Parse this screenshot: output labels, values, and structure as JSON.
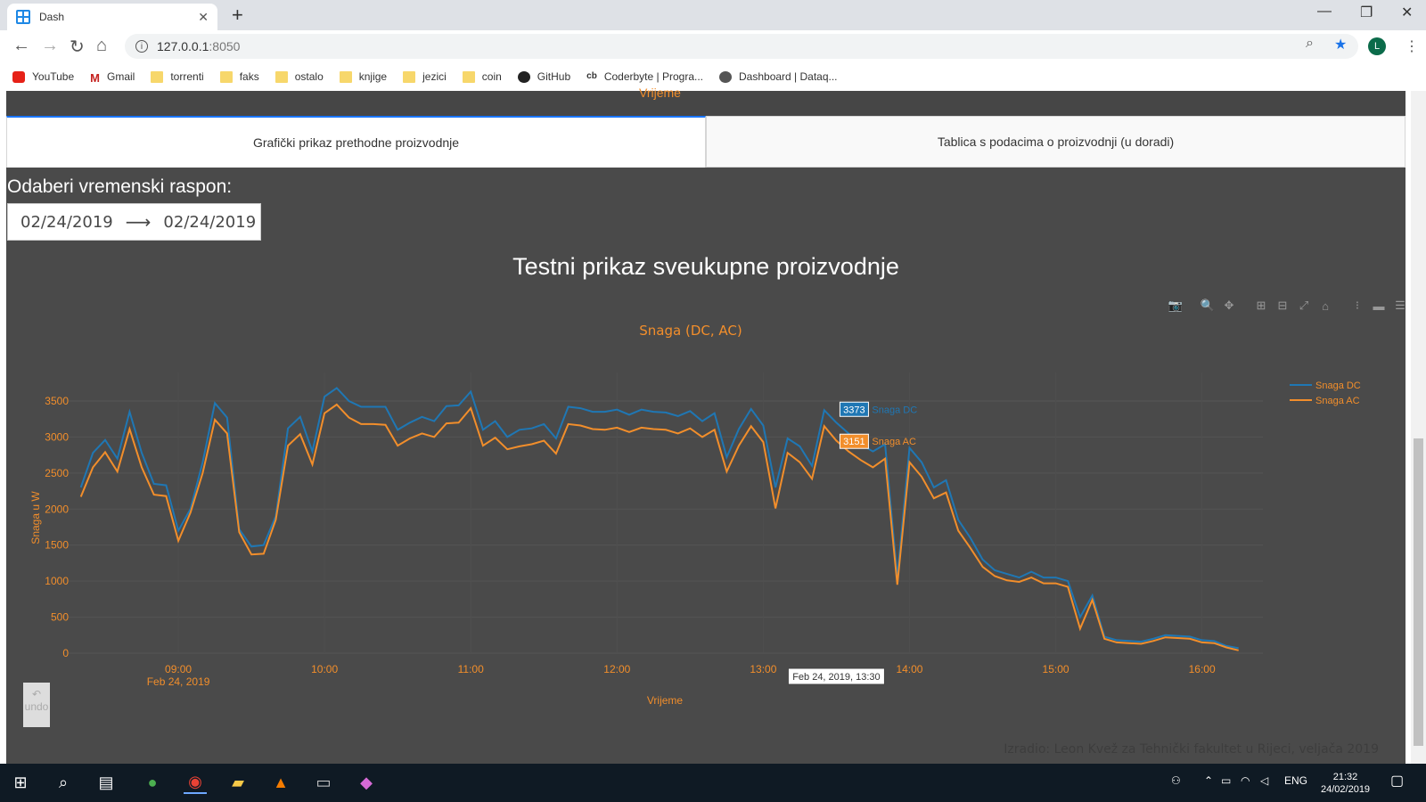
{
  "browser": {
    "tab_title": "Dash",
    "new_tab": "+",
    "url_host": "127.0.0.1",
    "url_port": ":8050",
    "avatar_letter": "L",
    "bookmarks": [
      {
        "label": "YouTube",
        "icon": "youtube-icon"
      },
      {
        "label": "Gmail",
        "icon": "gmail-icon"
      },
      {
        "label": "torrenti",
        "icon": "folder-icon"
      },
      {
        "label": "faks",
        "icon": "folder-icon"
      },
      {
        "label": "ostalo",
        "icon": "folder-icon"
      },
      {
        "label": "knjige",
        "icon": "folder-icon"
      },
      {
        "label": "jezici",
        "icon": "folder-icon"
      },
      {
        "label": "coin",
        "icon": "folder-icon"
      },
      {
        "label": "GitHub",
        "icon": "github-icon"
      },
      {
        "label": "Coderbyte | Progra...",
        "icon": "coderbyte-icon"
      },
      {
        "label": "Dashboard | Dataq...",
        "icon": "dataquest-icon"
      }
    ]
  },
  "page": {
    "strip_label": "Vrijeme",
    "tabs": [
      {
        "label": "Grafički prikaz prethodne proizvodnje",
        "active": true
      },
      {
        "label": "Tablica s podacima o proizvodnji (u doradi)",
        "active": false
      }
    ],
    "range_label": "Odaberi vremenski raspon:",
    "date_start": "02/24/2019",
    "date_end": "02/24/2019",
    "main_title": "Testni prikaz sveukupne proizvodnje",
    "undo_label": "undo",
    "footer": "Izradio: Leon Kvež za Tehnički fakultet u Rijeci, veljača 2019"
  },
  "colors": {
    "dc": "#1f77b4",
    "ac": "#f28e2b",
    "bg": "#4a4a4a",
    "accent_tab": "#1975fa"
  },
  "chart_data": {
    "type": "line",
    "title": "Snaga (DC, AC)",
    "xlabel": "Vrijeme",
    "ylabel": "Snaga u W",
    "ylim": [
      0,
      3700
    ],
    "yticks": [
      0,
      500,
      1000,
      1500,
      2000,
      2500,
      3000,
      3500
    ],
    "xtick_labels": [
      "09:00",
      "10:00",
      "11:00",
      "12:00",
      "13:00",
      "14:00",
      "15:00",
      "16:00"
    ],
    "xtick_date": "Feb 24, 2019",
    "x_start": "08:20",
    "x_step_minutes": 5,
    "legend_position": "top-right",
    "hover": {
      "time": "Feb 24, 2019, 13:30",
      "dc": 3373,
      "ac": 3151
    },
    "series": [
      {
        "name": "Snaga DC",
        "values": [
          2300,
          2780,
          2960,
          2700,
          3350,
          2780,
          2350,
          2330,
          1700,
          2000,
          2650,
          3470,
          3270,
          1720,
          1480,
          1500,
          1900,
          3120,
          3280,
          2800,
          3560,
          3680,
          3500,
          3420,
          3420,
          3420,
          3100,
          3200,
          3280,
          3220,
          3430,
          3440,
          3630,
          3100,
          3220,
          3000,
          3100,
          3120,
          3180,
          2980,
          3420,
          3400,
          3350,
          3350,
          3380,
          3310,
          3380,
          3350,
          3340,
          3290,
          3360,
          3220,
          3330,
          2720,
          3110,
          3390,
          3160,
          2300,
          2980,
          2870,
          2600,
          3373,
          3200,
          3050,
          2900,
          2800,
          2900,
          1050,
          2850,
          2650,
          2300,
          2400,
          1850,
          1600,
          1300,
          1150,
          1100,
          1050,
          1130,
          1050,
          1050,
          1000,
          500,
          800,
          230,
          180,
          170,
          160,
          200,
          250,
          240,
          230,
          180,
          170,
          100,
          70
        ]
      },
      {
        "name": "Snaga AC",
        "values": [
          2170,
          2580,
          2790,
          2520,
          3110,
          2580,
          2200,
          2180,
          1560,
          1950,
          2500,
          3240,
          3050,
          1680,
          1370,
          1380,
          1850,
          2880,
          3040,
          2620,
          3330,
          3450,
          3270,
          3180,
          3180,
          3170,
          2880,
          2980,
          3050,
          3000,
          3190,
          3200,
          3400,
          2880,
          2990,
          2830,
          2870,
          2900,
          2950,
          2770,
          3180,
          3160,
          3110,
          3100,
          3130,
          3070,
          3130,
          3110,
          3100,
          3050,
          3120,
          3000,
          3100,
          2520,
          2880,
          3150,
          2930,
          2010,
          2780,
          2650,
          2420,
          3151,
          2950,
          2800,
          2680,
          2580,
          2700,
          950,
          2650,
          2450,
          2150,
          2230,
          1700,
          1460,
          1200,
          1070,
          1010,
          990,
          1050,
          970,
          970,
          920,
          340,
          740,
          200,
          150,
          140,
          130,
          170,
          220,
          210,
          200,
          150,
          140,
          80,
          40
        ]
      }
    ]
  }
}
